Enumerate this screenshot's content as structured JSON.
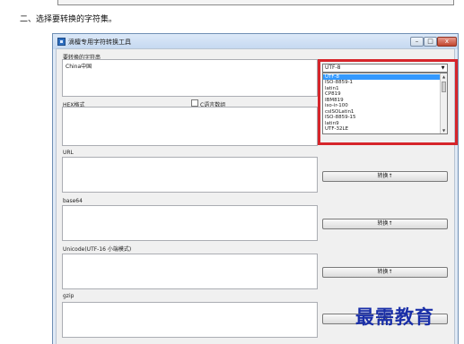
{
  "document": {
    "step_heading": "二、选择要转换的字符集。"
  },
  "window": {
    "title": "滴檀专用字符转换工具",
    "controls": {
      "minimize": "–",
      "maximize": "□",
      "close": "x"
    }
  },
  "form": {
    "source_label": "要转换的字符串",
    "source_value": "China中国",
    "charset": {
      "selected": "UTF-8",
      "options": [
        "UTF-8",
        "ISO-8859-1",
        "latin1",
        "CP819",
        "IBM819",
        "iso-ir-100",
        "csISOLatin1",
        "ISO-8859-15",
        "latin9",
        "UTF-32LE"
      ],
      "highlighted_index": 0
    },
    "hex_label": "HEX格式",
    "c_array_label": "C语言数组",
    "c_array_checked": false,
    "sections": [
      {
        "label": "URL",
        "button": "转换↑"
      },
      {
        "label": "base64",
        "button": "转换↑"
      },
      {
        "label": "Unicode(UTF-16 小端模式)",
        "button": "转换↑"
      },
      {
        "label": "gzip",
        "button": "转换↑"
      }
    ]
  },
  "watermark": "最需教育",
  "icons": [
    "app-icon",
    "minimize-icon",
    "maximize-icon",
    "close-icon",
    "chevron-down-icon",
    "scroll-up-icon",
    "scroll-down-icon"
  ],
  "colors": {
    "highlight_border": "#d6252b",
    "selection": "#3399ff",
    "watermark": "#1a2fa8"
  }
}
